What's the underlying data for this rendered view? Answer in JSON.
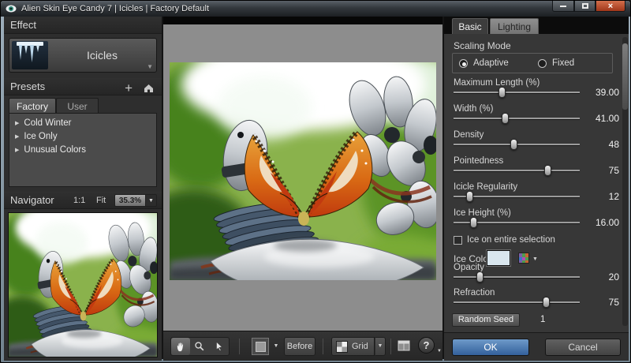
{
  "window": {
    "title": "Alien Skin Eye Candy 7 | Icicles | Factory Default"
  },
  "left": {
    "effect_header": "Effect",
    "effect_button": "Icicles",
    "presets_header": "Presets",
    "preset_tabs": [
      "Factory",
      "User"
    ],
    "preset_items": [
      "Cold Winter",
      "Ice Only",
      "Unusual Colors"
    ],
    "navigator_header": "Navigator",
    "zoom_1to1": "1:1",
    "zoom_fit": "Fit",
    "zoom_level": "35.3%"
  },
  "panel": {
    "tabs": [
      "Basic",
      "Lighting"
    ],
    "scaling_mode_label": "Scaling Mode",
    "radio_options": [
      "Adaptive",
      "Fixed"
    ],
    "radio_selected": "Adaptive",
    "sliders": [
      {
        "label": "Maximum Length (%)",
        "value": "39.00",
        "pct": 39
      },
      {
        "label": "Width (%)",
        "value": "41.00",
        "pct": 41
      },
      {
        "label": "Density",
        "value": "48",
        "pct": 48
      },
      {
        "label": "Pointedness",
        "value": "75",
        "pct": 75
      },
      {
        "label": "Icicle Regularity",
        "value": "12",
        "pct": 13
      },
      {
        "label": "Ice Height (%)",
        "value": "16.00",
        "pct": 16
      },
      {
        "label": "Opacity",
        "value": "20",
        "pct": 21
      },
      {
        "label": "Refraction",
        "value": "75",
        "pct": 74
      }
    ],
    "ice_checkbox_label": "Ice on entire selection",
    "ice_color_label": "Ice Color",
    "ice_color_value": "#d9e6ee",
    "random_seed_button": "Random Seed",
    "random_seed_value": "1",
    "ok_button": "OK",
    "cancel_button": "Cancel"
  },
  "toolbar": {
    "before_button": "Before",
    "grid_button": "Grid",
    "help_button": "?"
  },
  "colors": {
    "ok_blue": "#33609b",
    "ice_swatch": "#d9e6ee"
  }
}
